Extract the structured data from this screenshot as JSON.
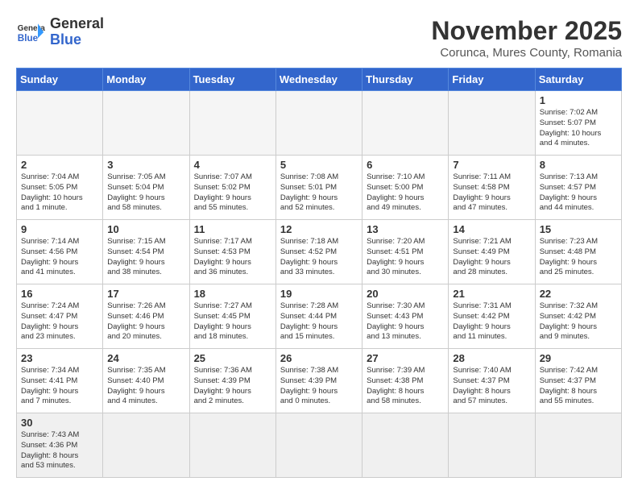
{
  "logo": {
    "text_general": "General",
    "text_blue": "Blue"
  },
  "header": {
    "month": "November 2025",
    "location": "Corunca, Mures County, Romania"
  },
  "weekdays": [
    "Sunday",
    "Monday",
    "Tuesday",
    "Wednesday",
    "Thursday",
    "Friday",
    "Saturday"
  ],
  "weeks": [
    [
      {
        "day": "",
        "info": ""
      },
      {
        "day": "",
        "info": ""
      },
      {
        "day": "",
        "info": ""
      },
      {
        "day": "",
        "info": ""
      },
      {
        "day": "",
        "info": ""
      },
      {
        "day": "",
        "info": ""
      },
      {
        "day": "1",
        "info": "Sunrise: 7:02 AM\nSunset: 5:07 PM\nDaylight: 10 hours\nand 4 minutes."
      }
    ],
    [
      {
        "day": "2",
        "info": "Sunrise: 7:04 AM\nSunset: 5:05 PM\nDaylight: 10 hours\nand 1 minute."
      },
      {
        "day": "3",
        "info": "Sunrise: 7:05 AM\nSunset: 5:04 PM\nDaylight: 9 hours\nand 58 minutes."
      },
      {
        "day": "4",
        "info": "Sunrise: 7:07 AM\nSunset: 5:02 PM\nDaylight: 9 hours\nand 55 minutes."
      },
      {
        "day": "5",
        "info": "Sunrise: 7:08 AM\nSunset: 5:01 PM\nDaylight: 9 hours\nand 52 minutes."
      },
      {
        "day": "6",
        "info": "Sunrise: 7:10 AM\nSunset: 5:00 PM\nDaylight: 9 hours\nand 49 minutes."
      },
      {
        "day": "7",
        "info": "Sunrise: 7:11 AM\nSunset: 4:58 PM\nDaylight: 9 hours\nand 47 minutes."
      },
      {
        "day": "8",
        "info": "Sunrise: 7:13 AM\nSunset: 4:57 PM\nDaylight: 9 hours\nand 44 minutes."
      }
    ],
    [
      {
        "day": "9",
        "info": "Sunrise: 7:14 AM\nSunset: 4:56 PM\nDaylight: 9 hours\nand 41 minutes."
      },
      {
        "day": "10",
        "info": "Sunrise: 7:15 AM\nSunset: 4:54 PM\nDaylight: 9 hours\nand 38 minutes."
      },
      {
        "day": "11",
        "info": "Sunrise: 7:17 AM\nSunset: 4:53 PM\nDaylight: 9 hours\nand 36 minutes."
      },
      {
        "day": "12",
        "info": "Sunrise: 7:18 AM\nSunset: 4:52 PM\nDaylight: 9 hours\nand 33 minutes."
      },
      {
        "day": "13",
        "info": "Sunrise: 7:20 AM\nSunset: 4:51 PM\nDaylight: 9 hours\nand 30 minutes."
      },
      {
        "day": "14",
        "info": "Sunrise: 7:21 AM\nSunset: 4:49 PM\nDaylight: 9 hours\nand 28 minutes."
      },
      {
        "day": "15",
        "info": "Sunrise: 7:23 AM\nSunset: 4:48 PM\nDaylight: 9 hours\nand 25 minutes."
      }
    ],
    [
      {
        "day": "16",
        "info": "Sunrise: 7:24 AM\nSunset: 4:47 PM\nDaylight: 9 hours\nand 23 minutes."
      },
      {
        "day": "17",
        "info": "Sunrise: 7:26 AM\nSunset: 4:46 PM\nDaylight: 9 hours\nand 20 minutes."
      },
      {
        "day": "18",
        "info": "Sunrise: 7:27 AM\nSunset: 4:45 PM\nDaylight: 9 hours\nand 18 minutes."
      },
      {
        "day": "19",
        "info": "Sunrise: 7:28 AM\nSunset: 4:44 PM\nDaylight: 9 hours\nand 15 minutes."
      },
      {
        "day": "20",
        "info": "Sunrise: 7:30 AM\nSunset: 4:43 PM\nDaylight: 9 hours\nand 13 minutes."
      },
      {
        "day": "21",
        "info": "Sunrise: 7:31 AM\nSunset: 4:42 PM\nDaylight: 9 hours\nand 11 minutes."
      },
      {
        "day": "22",
        "info": "Sunrise: 7:32 AM\nSunset: 4:42 PM\nDaylight: 9 hours\nand 9 minutes."
      }
    ],
    [
      {
        "day": "23",
        "info": "Sunrise: 7:34 AM\nSunset: 4:41 PM\nDaylight: 9 hours\nand 7 minutes."
      },
      {
        "day": "24",
        "info": "Sunrise: 7:35 AM\nSunset: 4:40 PM\nDaylight: 9 hours\nand 4 minutes."
      },
      {
        "day": "25",
        "info": "Sunrise: 7:36 AM\nSunset: 4:39 PM\nDaylight: 9 hours\nand 2 minutes."
      },
      {
        "day": "26",
        "info": "Sunrise: 7:38 AM\nSunset: 4:39 PM\nDaylight: 9 hours\nand 0 minutes."
      },
      {
        "day": "27",
        "info": "Sunrise: 7:39 AM\nSunset: 4:38 PM\nDaylight: 8 hours\nand 58 minutes."
      },
      {
        "day": "28",
        "info": "Sunrise: 7:40 AM\nSunset: 4:37 PM\nDaylight: 8 hours\nand 57 minutes."
      },
      {
        "day": "29",
        "info": "Sunrise: 7:42 AM\nSunset: 4:37 PM\nDaylight: 8 hours\nand 55 minutes."
      }
    ],
    [
      {
        "day": "30",
        "info": "Sunrise: 7:43 AM\nSunset: 4:36 PM\nDaylight: 8 hours\nand 53 minutes."
      },
      {
        "day": "",
        "info": ""
      },
      {
        "day": "",
        "info": ""
      },
      {
        "day": "",
        "info": ""
      },
      {
        "day": "",
        "info": ""
      },
      {
        "day": "",
        "info": ""
      },
      {
        "day": "",
        "info": ""
      }
    ]
  ]
}
